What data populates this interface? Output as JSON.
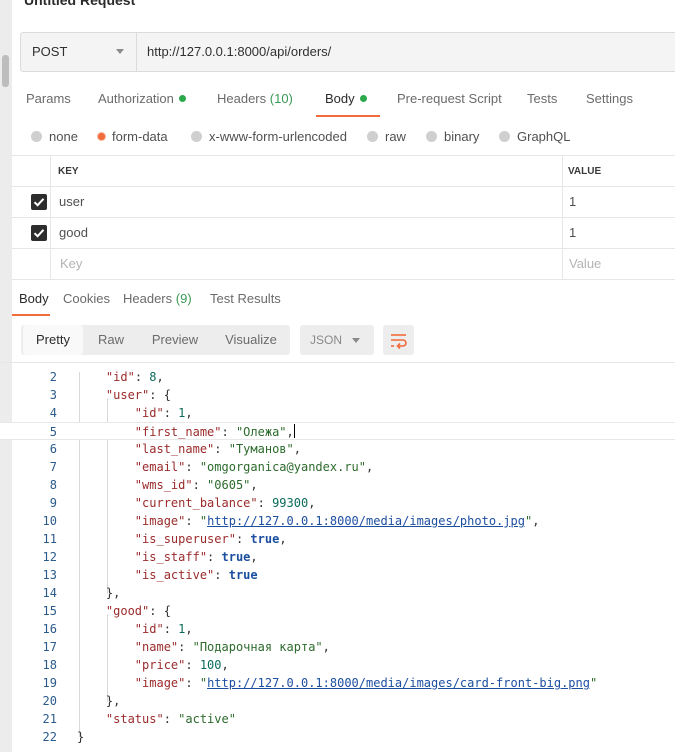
{
  "request": {
    "title": "Untitled Request",
    "method": "POST",
    "url": "http://127.0.0.1:8000/api/orders/"
  },
  "request_tabs": [
    {
      "label": "Params"
    },
    {
      "label": "Authorization"
    },
    {
      "label": "Headers",
      "count": "(10)"
    },
    {
      "label": "Body"
    },
    {
      "label": "Pre-request Script"
    },
    {
      "label": "Tests"
    },
    {
      "label": "Settings"
    }
  ],
  "body_types": [
    "none",
    "form-data",
    "x-www-form-urlencoded",
    "raw",
    "binary",
    "GraphQL"
  ],
  "body_type_selected": "form-data",
  "form_table": {
    "headers": [
      "KEY",
      "VALUE"
    ],
    "rows": [
      {
        "checked": true,
        "key": "user",
        "value": "1"
      },
      {
        "checked": true,
        "key": "good",
        "value": "1"
      }
    ],
    "placeholder": {
      "key": "Key",
      "value": "Value"
    }
  },
  "response_tabs": [
    {
      "label": "Body"
    },
    {
      "label": "Cookies"
    },
    {
      "label": "Headers",
      "count": "(9)"
    },
    {
      "label": "Test Results"
    }
  ],
  "view_modes": [
    "Pretty",
    "Raw",
    "Preview",
    "Visualize"
  ],
  "format": "JSON",
  "icons": {
    "wrap": "wrap-lines-icon",
    "check": "check-icon",
    "caret": "chevron-down-icon"
  },
  "colors": {
    "accent": "#f26b3a",
    "status_dot": "#2aa84a",
    "json_key": "#9b2b2b",
    "json_string": "#2d6b2d",
    "json_number": "#0a6b5a",
    "json_bool": "#1d4fa0"
  },
  "code_lines": [
    {
      "n": "2",
      "html": "    <span class=\"k\">\"id\"</span>: <span class=\"n\">8</span>,"
    },
    {
      "n": "3",
      "html": "    <span class=\"k\">\"user\"</span>: {"
    },
    {
      "n": "4",
      "html": "        <span class=\"k\">\"id\"</span>: <span class=\"n\">1</span>,"
    },
    {
      "n": "5",
      "html": "        <span class=\"k\">\"first_name\"</span>: <span class=\"s\">\"Олежа\"</span>,<span class=\"cursor\"></span>"
    },
    {
      "n": "6",
      "html": "        <span class=\"k\">\"last_name\"</span>: <span class=\"s\">\"Туманов\"</span>,"
    },
    {
      "n": "7",
      "html": "        <span class=\"k\">\"email\"</span>: <span class=\"s\">\"omgorganica@yandex.ru\"</span>,"
    },
    {
      "n": "8",
      "html": "        <span class=\"k\">\"wms_id\"</span>: <span class=\"s\">\"0605\"</span>,"
    },
    {
      "n": "9",
      "html": "        <span class=\"k\">\"current_balance\"</span>: <span class=\"n\">99300</span>,"
    },
    {
      "n": "10",
      "html": "        <span class=\"k\">\"image\"</span>: <span class=\"s\">\"</span><span class=\"u\">http://127.0.0.1:8000/media/images/photo.jpg</span><span class=\"s\">\"</span>,"
    },
    {
      "n": "11",
      "html": "        <span class=\"k\">\"is_superuser\"</span>: <span class=\"b\">true</span>,"
    },
    {
      "n": "12",
      "html": "        <span class=\"k\">\"is_staff\"</span>: <span class=\"b\">true</span>,"
    },
    {
      "n": "13",
      "html": "        <span class=\"k\">\"is_active\"</span>: <span class=\"b\">true</span>"
    },
    {
      "n": "14",
      "html": "    },"
    },
    {
      "n": "15",
      "html": "    <span class=\"k\">\"good\"</span>: {"
    },
    {
      "n": "16",
      "html": "        <span class=\"k\">\"id\"</span>: <span class=\"n\">1</span>,"
    },
    {
      "n": "17",
      "html": "        <span class=\"k\">\"name\"</span>: <span class=\"s\">\"Подарочная карта\"</span>,"
    },
    {
      "n": "18",
      "html": "        <span class=\"k\">\"price\"</span>: <span class=\"n\">100</span>,"
    },
    {
      "n": "19",
      "html": "        <span class=\"k\">\"image\"</span>: <span class=\"s\">\"</span><span class=\"u\">http://127.0.0.1:8000/media/images/card-front-big.png</span><span class=\"s\">\"</span>"
    },
    {
      "n": "20",
      "html": "    },"
    },
    {
      "n": "21",
      "html": "    <span class=\"k\">\"status\"</span>: <span class=\"s\">\"active\"</span>"
    },
    {
      "n": "22",
      "html": "}"
    }
  ]
}
